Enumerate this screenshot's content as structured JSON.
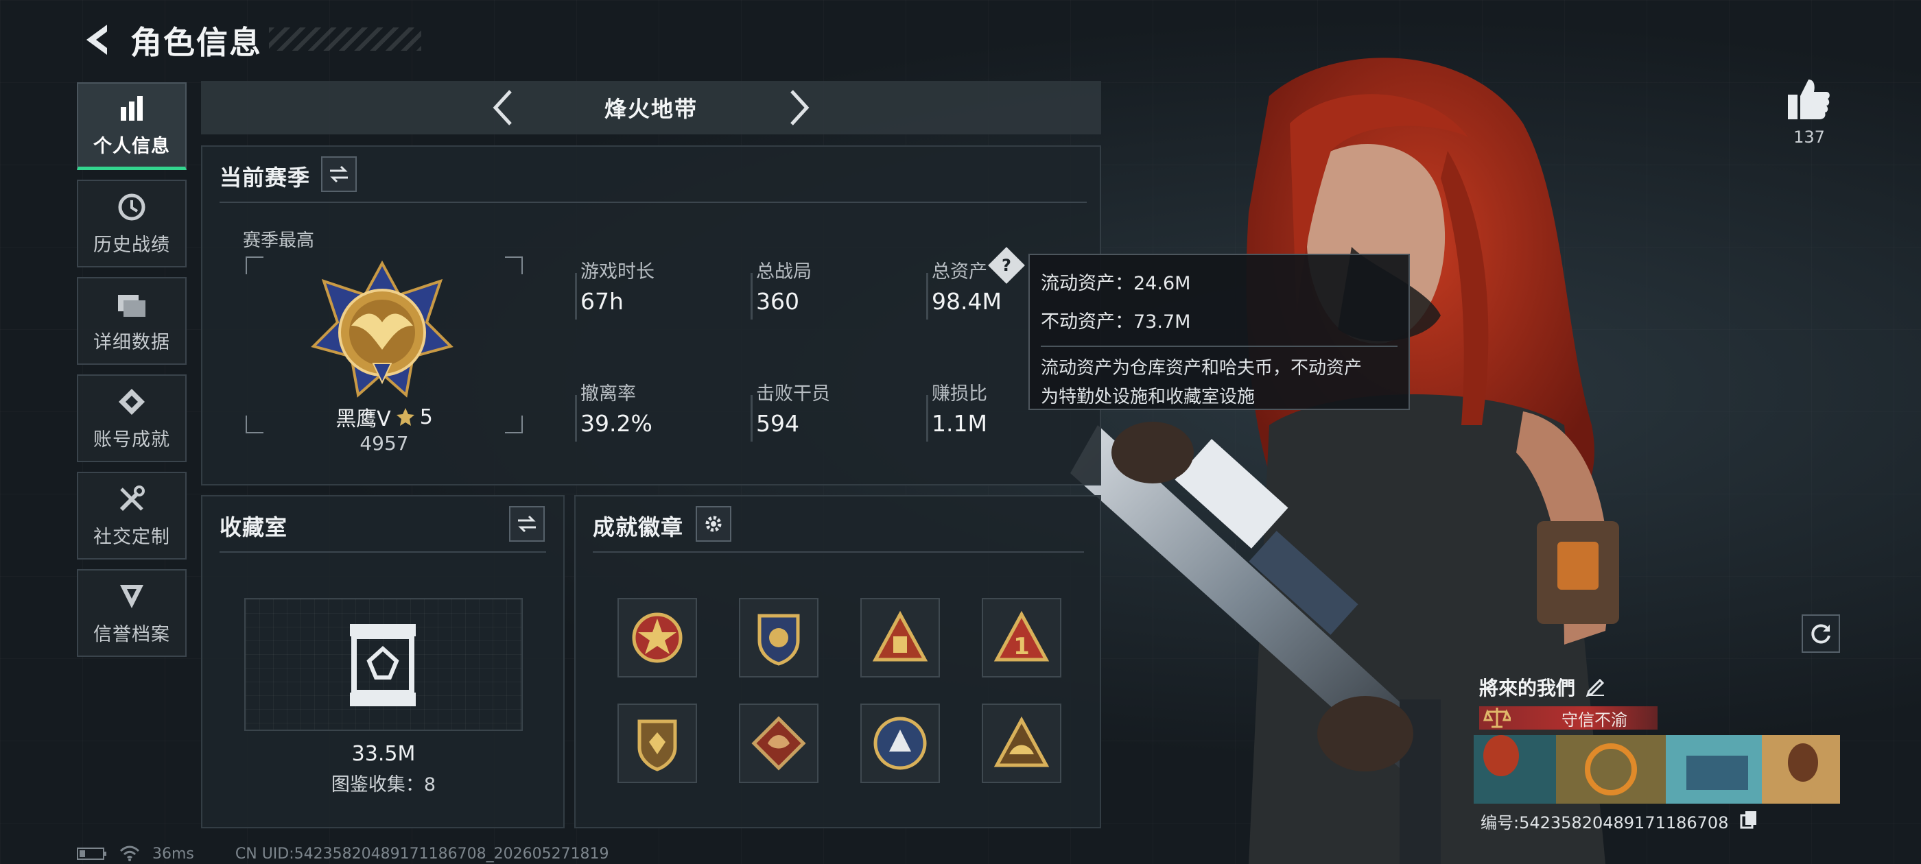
{
  "header": {
    "title": "角色信息"
  },
  "nav": {
    "items": [
      {
        "label": "个人信息",
        "icon": "bar-chart-icon",
        "active": true
      },
      {
        "label": "历史战绩",
        "icon": "history-clock-icon",
        "active": false
      },
      {
        "label": "详细数据",
        "icon": "folder-icon",
        "active": false
      },
      {
        "label": "账号成就",
        "icon": "achievement-icon",
        "active": false
      },
      {
        "label": "社交定制",
        "icon": "tools-icon",
        "active": false
      },
      {
        "label": "信誉档案",
        "icon": "shield-credit-icon",
        "active": false
      }
    ]
  },
  "mode": {
    "name": "烽火地带"
  },
  "season": {
    "title": "当前赛季",
    "best_label": "赛季最高",
    "rank_name": "黑鹰V",
    "rank_stars": "5",
    "rank_score": "4957",
    "stats": [
      {
        "label": "游戏时长",
        "value": "67h"
      },
      {
        "label": "总战局",
        "value": "360"
      },
      {
        "label": "总资产",
        "value": "98.4M"
      },
      {
        "label": "撤离率",
        "value": "39.2%"
      },
      {
        "label": "击败干员",
        "value": "594"
      },
      {
        "label": "赚损比",
        "value": "1.1M"
      }
    ]
  },
  "tooltip": {
    "liquid": "流动资产：24.6M",
    "fixed": "不动资产：73.7M",
    "desc_line1": "流动资产为仓库资产和哈夫币，不动资产",
    "desc_line2": "为特勤处设施和收藏室设施"
  },
  "collection": {
    "title": "收藏室",
    "value": "33.5M",
    "count_text": "图鉴收集：8"
  },
  "achievements": {
    "title": "成就徽章",
    "badges": [
      "star-badge-icon",
      "wings-badge-icon",
      "triangle-badge-icon",
      "number-one-badge-icon",
      "shield-badge-icon",
      "dragon-badge-icon",
      "circle-emblem-badge-icon",
      "eagle-badge-icon"
    ]
  },
  "profile": {
    "likes": "137",
    "player_name": "將來的我們",
    "honor_title": "守信不渝",
    "id_text": "编号:54235820489171186708"
  },
  "status_bar": {
    "ping": "36ms",
    "uid": "CN UID:54235820489171186708_202605271819"
  },
  "colors": {
    "accent_green": "#33d68f",
    "honor_red": "#b3302e"
  }
}
